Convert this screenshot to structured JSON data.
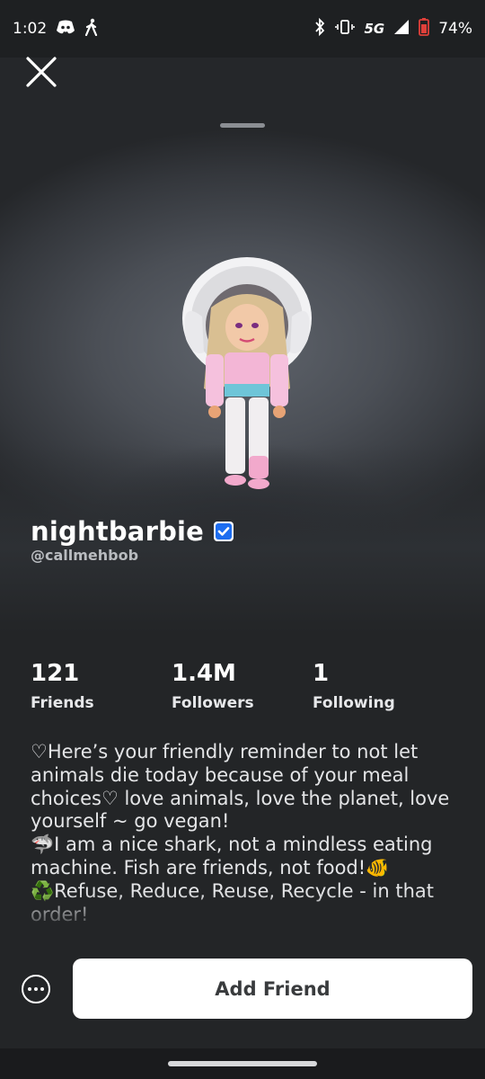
{
  "status_bar": {
    "time": "1:02",
    "network": "5G",
    "battery": "74%"
  },
  "profile": {
    "display_name": "nightbarbie",
    "username": "@callmehbob",
    "verified": true
  },
  "stats": [
    {
      "value": "121",
      "label": "Friends"
    },
    {
      "value": "1.4M",
      "label": "Followers"
    },
    {
      "value": "1",
      "label": "Following"
    }
  ],
  "bio": {
    "line1": "♡Here’s your friendly reminder to not let animals die today because of your meal choices♡ love animals, love the planet, love yourself ~ go vegan!",
    "line2": "🦈I am a nice shark, not a mindless eating machine. Fish are friends, not food!🐠",
    "line3": "♻️Refuse, Reduce, Reuse, Recycle - in that order!"
  },
  "actions": {
    "add_friend_label": "Add Friend"
  },
  "icons": {
    "close": "close-icon",
    "more": "more-icon",
    "verified": "verified-badge-icon",
    "discord": "discord-icon",
    "walk": "walking-icon",
    "bluetooth": "bluetooth-icon",
    "vibrate": "vibrate-icon",
    "signal": "signal-icon",
    "battery": "battery-icon"
  },
  "colors": {
    "background": "#232527",
    "verified_blue": "#1d6df0",
    "button_bg": "#ffffff",
    "button_text": "#393b3d",
    "battery_red": "#e0403a"
  }
}
